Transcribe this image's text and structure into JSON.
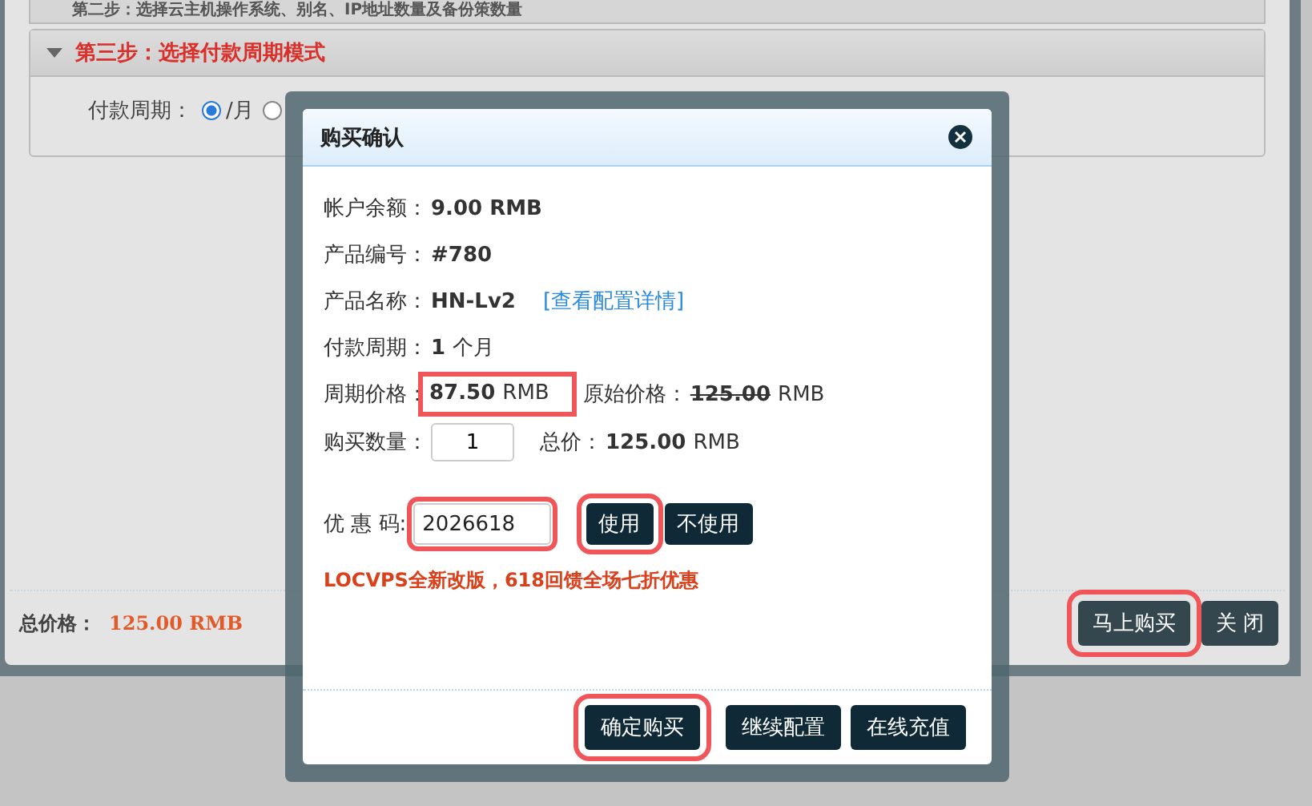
{
  "page": {
    "step2_title": "第二步：选择云主机操作系统、别名、IP地址数量及备份策数量",
    "step3_title": "第三步：选择付款周期模式",
    "period_label": "付款周期：",
    "period_options": [
      {
        "label": "/月",
        "selected": true
      },
      {
        "selected": false
      }
    ],
    "total_label": "总价格：",
    "total_value": "125.00 RMB",
    "buttons": [
      {
        "label": "马上购买",
        "highlighted": true
      },
      {
        "label": "关 闭",
        "highlighted": false
      }
    ]
  },
  "dialog": {
    "title": "购买确认",
    "rows": [
      {
        "kind": "info",
        "label": "帐户余额：",
        "value": "9.00 RMB"
      },
      {
        "kind": "info",
        "label": "产品编号：",
        "value": "#780"
      },
      {
        "kind": "info",
        "label": "产品名称：",
        "value": "HN-Lv2",
        "link": "[查看配置详情]"
      },
      {
        "kind": "info",
        "label": "付款周期：",
        "value": "1",
        "unit": "个月"
      },
      {
        "kind": "price",
        "label": "周期价格：",
        "value": "87.50",
        "unit": "RMB",
        "highlighted": true,
        "label2": "原始价格：",
        "value2": "125.00",
        "unit2": "RMB",
        "struck": true
      },
      {
        "kind": "quantity",
        "label": "购买数量：",
        "value": "1",
        "label2": "总价：",
        "value2": "125.00",
        "unit2": "RMB"
      }
    ],
    "coupon": {
      "label": "优 惠 码:",
      "value": "2026618",
      "highlighted": true,
      "buttons": [
        {
          "label": "使用",
          "highlighted": true
        },
        {
          "label": "不使用",
          "highlighted": false
        }
      ]
    },
    "promo": "LOCVPS全新改版，618回馈全场七折优惠",
    "buttons": [
      {
        "label": "确定购买",
        "highlighted": true
      },
      {
        "label": "继续配置",
        "highlighted": false
      },
      {
        "label": "在线充值",
        "highlighted": false
      }
    ]
  }
}
